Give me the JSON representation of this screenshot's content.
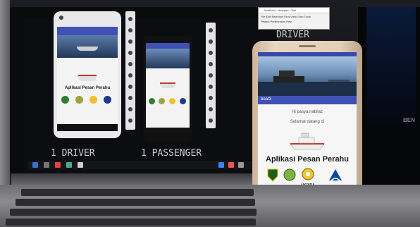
{
  "labels": {
    "driver_top": "DRIVER",
    "driver_bottom": "1 DRIVER",
    "passenger_bottom": "1 PASSENGER"
  },
  "app": {
    "title": "Aplikasi Pesan Perahu",
    "greeting_user": "Hi pasya.nabilaz",
    "welcome": "Selamat datang di",
    "tab_label": "boat3",
    "logo_names": [
      "provinsi-logo",
      "green-emblem-logo",
      "ukrida-logo",
      "blue-logo"
    ],
    "logo_captions": [
      "UKRIDA"
    ]
  },
  "notepad": {
    "title": "localhost - Notepad - Test",
    "menu": [
      "File",
      "Edit",
      "Selection",
      "Find",
      "View",
      "Goto",
      "Tools"
    ],
    "menu2": [
      "Project",
      "Preferences",
      "Help"
    ]
  },
  "monitor": {
    "brand": "BEN"
  },
  "colors": {
    "appbar": "#3f51b5",
    "boat_hull": "#e8e8e8",
    "boat_stripe": "#c0392b"
  }
}
